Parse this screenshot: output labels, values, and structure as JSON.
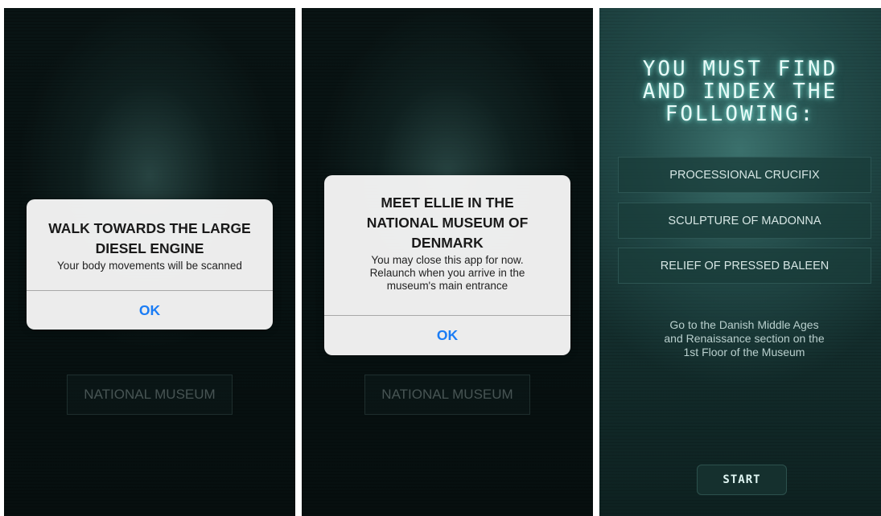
{
  "screens": [
    {
      "museum_button_label": "NATIONAL MUSEUM",
      "alert": {
        "title": "WALK TOWARDS THE LARGE\nDIESEL ENGINE",
        "message": "Your body movements will be scanned",
        "ok_label": "OK"
      }
    },
    {
      "museum_button_label": "NATIONAL MUSEUM",
      "alert": {
        "title": "MEET ELLIE IN THE\nNATIONAL MUSEUM OF\nDENMARK",
        "message": "You may close this app for now.\nRelaunch when you arrive in the\nmuseum's main entrance",
        "ok_label": "OK"
      }
    },
    {
      "title": "YOU  MUST FIND\nAND INDEX THE\nFOLLOWING:",
      "items": [
        {
          "label": "PROCESSIONAL CRUCIFIX"
        },
        {
          "label": "SCULPTURE OF MADONNA"
        },
        {
          "label": "RELIEF OF PRESSED BALEEN"
        }
      ],
      "directions": "Go to the Danish Middle Ages\nand Renaissance section on the\n1st Floor of the Museum",
      "start_label": "START"
    }
  ],
  "colors": {
    "background": "#0b1a1a",
    "alert_background": "#f4f4f4",
    "ok_blue": "#1a7cf5",
    "glow_text": "#e8fbf8"
  }
}
